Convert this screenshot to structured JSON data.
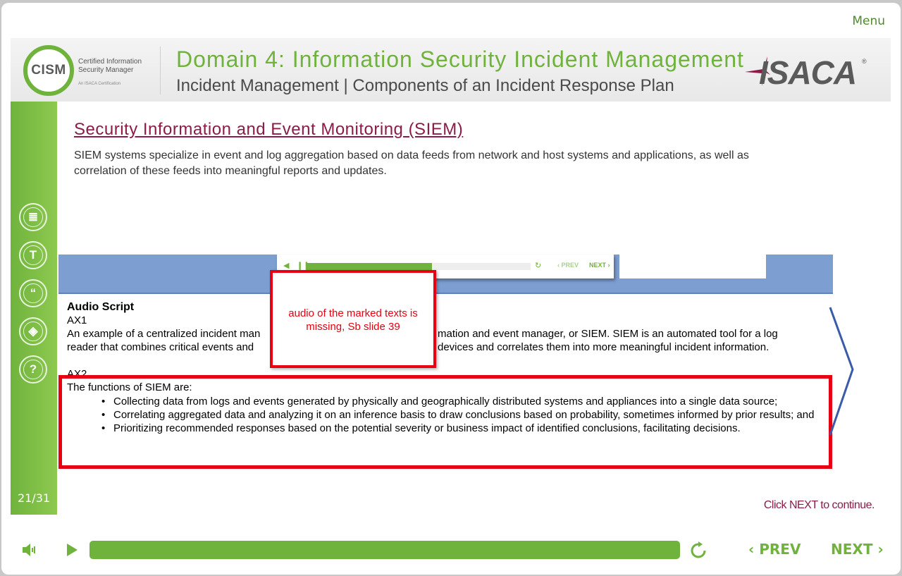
{
  "menu_label": "Menu",
  "header": {
    "logo_text": "CISM",
    "logo_line1": "Certified Information",
    "logo_line2": "Security Manager",
    "logo_tagline": "An ISACA Certification",
    "domain_title": "Domain 4: Information Security Incident Management",
    "domain_subtitle": "Incident Management | Components of an Incident Response Plan",
    "isaca_logo": "ISACA"
  },
  "sidebar": {
    "buttons": [
      {
        "icon": "notes-icon",
        "glyph": "≣"
      },
      {
        "icon": "transcript-icon",
        "glyph": "T"
      },
      {
        "icon": "quote-icon",
        "glyph": "“"
      },
      {
        "icon": "layers-icon",
        "glyph": "◈"
      },
      {
        "icon": "help-icon",
        "glyph": "?"
      }
    ],
    "slide_counter": "21/31"
  },
  "slide": {
    "title": "Security Information and Event Monitoring (SIEM)",
    "body": "SIEM systems specialize in event and log aggregation based on data feeds from network and host systems and applications, as well as correlation of these feeds into meaningful reports and updates."
  },
  "mini_player": {
    "prev_label": "‹ PREV",
    "next_label": "NEXT ›",
    "progress": 0.56
  },
  "audio_script": {
    "title": "Audio Script",
    "ax1_label": "AX1",
    "ax1_line1_a": "An example of a centralized incident man",
    "ax1_line1_b": "mation and event manager, or SIEM. SIEM is an automated tool for a log",
    "ax1_line2_a": "reader that combines critical events and",
    "ax1_line2_b": "devices and correlates them into more meaningful incident information.",
    "ax2_label": "AX2",
    "functions_title": "The functions of SIEM are:",
    "functions": [
      "Collecting data from logs and events generated by physically and geographically distributed systems and appliances into a single data source;",
      "Correlating aggregated data and analyzing it on an inference basis to draw conclusions based on probability, sometimes informed by prior results; and",
      "Prioritizing recommended responses based on the potential severity or business impact of identified conclusions, facilitating decisions."
    ]
  },
  "review_comment": "audio of the marked texts is missing, Sb slide 39",
  "click_next_hint": "Click NEXT to continue.",
  "player": {
    "progress": 1.0,
    "prev_label": "PREV",
    "next_label": "NEXT"
  },
  "colors": {
    "brand_green": "#6fb33d",
    "title_maroon": "#8b1c49",
    "annotation_red": "#e60012",
    "notes_blue": "#7d9ed0"
  }
}
